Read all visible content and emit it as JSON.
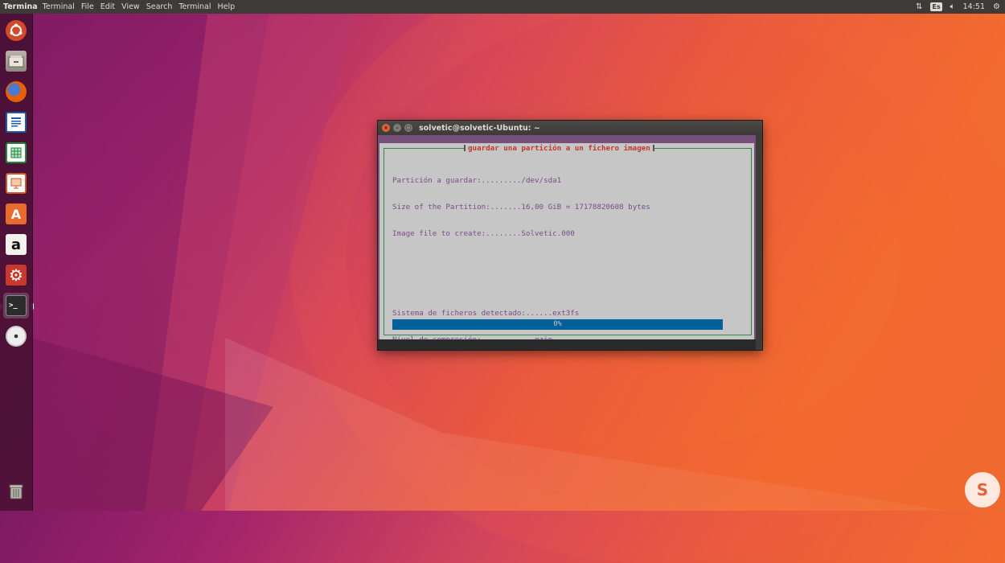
{
  "top_panel": {
    "app_name": "Termina",
    "menus": [
      "Terminal",
      "File",
      "Edit",
      "View",
      "Search",
      "Terminal",
      "Help"
    ],
    "keyboard_layout": "Es",
    "time": "14:51"
  },
  "launcher": {
    "icons": [
      "ubuntu-dash-icon",
      "files-icon",
      "firefox-icon",
      "writer-icon",
      "calc-icon",
      "impress-icon",
      "software-center-icon",
      "amazon-icon",
      "system-settings-icon",
      "terminal-icon",
      "dvd-icon",
      "trash-icon"
    ],
    "amazon_glyph": "a",
    "software_glyph": "A",
    "terminal_glyph": ">_"
  },
  "terminal": {
    "title": "solvetic@solvetic-Ubuntu: ~",
    "dialog": {
      "title": "guardar una partición a un fichero imagen",
      "lines": [
        "Partición a guardar:........./dev/sda1",
        "Size of the Partition:.......16,00 GiB = 17178820608 bytes",
        "Image file to create:........Solvetic.000",
        "",
        "",
        "Sistema de ficheros detectado:......ext3fs",
        "Nivel de compresión:............gzip"
      ],
      "progress_percent": 0,
      "progress_label": "0%"
    }
  },
  "watermark": {
    "glyph": "S"
  }
}
